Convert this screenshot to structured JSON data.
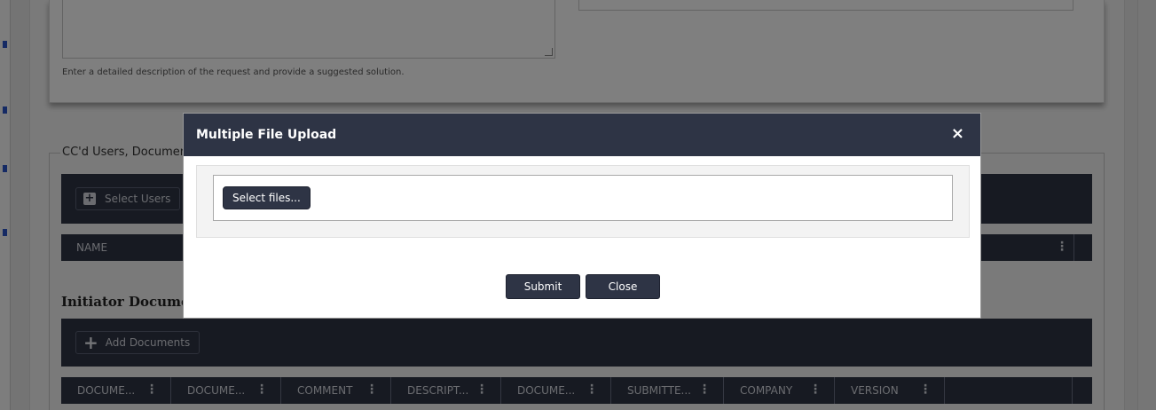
{
  "form": {
    "description_helper": "Enter a detailed description of the request and provide a suggested solution."
  },
  "cc_section": {
    "legend": "CC'd Users, Documents",
    "select_users_label": "Select Users",
    "grid_columns": [
      "NAME"
    ]
  },
  "initiator_section": {
    "title": "Initiator Documents",
    "add_documents_label": "Add Documents",
    "grid_columns": [
      "DOCUME...",
      "DOCUME...",
      "COMMENT",
      "DESCRIPT...",
      "DOCUME...",
      "SUBMITTE...",
      "COMPANY",
      "VERSION"
    ]
  },
  "modal": {
    "title": "Multiple File Upload",
    "close_icon": "×",
    "select_files_label": "Select files...",
    "submit_label": "Submit",
    "close_label": "Close"
  },
  "icons": {
    "kebab": "⋮",
    "plus_box": "+",
    "plus": "+"
  },
  "colors": {
    "header_dark": "#2e3445",
    "overlay": "rgba(0,0,0,0.5)"
  }
}
